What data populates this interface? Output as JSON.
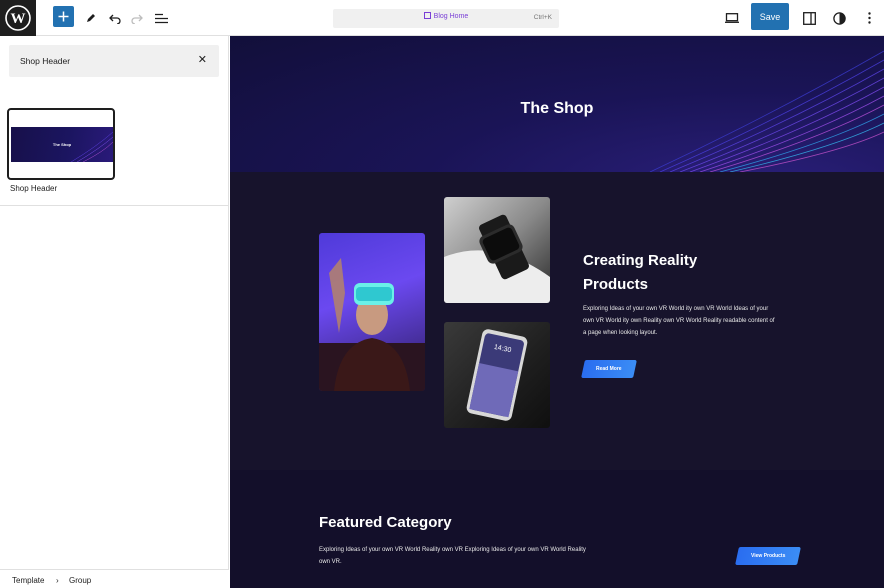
{
  "toolbar": {
    "command_title": "Blog Home",
    "command_shortcut": "Ctrl+K",
    "save_label": "Save"
  },
  "sidebar": {
    "search_value": "Shop Header",
    "pattern": {
      "thumb_title": "The Shop",
      "label": "Shop Header"
    }
  },
  "breadcrumb": {
    "items": [
      "Template",
      "Group"
    ]
  },
  "canvas": {
    "hero_title": "The Shop",
    "section2": {
      "heading": "Creating Reality Products",
      "text": "Exploring Ideas of your own VR World ity own VR World Ideas of your own VR World ity own Reality own VR World Reality readable content of a page when looking layout.",
      "button": "Read More"
    },
    "section3": {
      "heading": "Featured Category",
      "text": "Exploring Ideas of your own VR World Reality own VR Exploring Ideas of your own VR World Reality own VR.",
      "button": "View Products"
    }
  },
  "colors": {
    "accent": "#2271b1",
    "canvas_bg": "#16122a",
    "hero_bg": "#1a1456"
  }
}
